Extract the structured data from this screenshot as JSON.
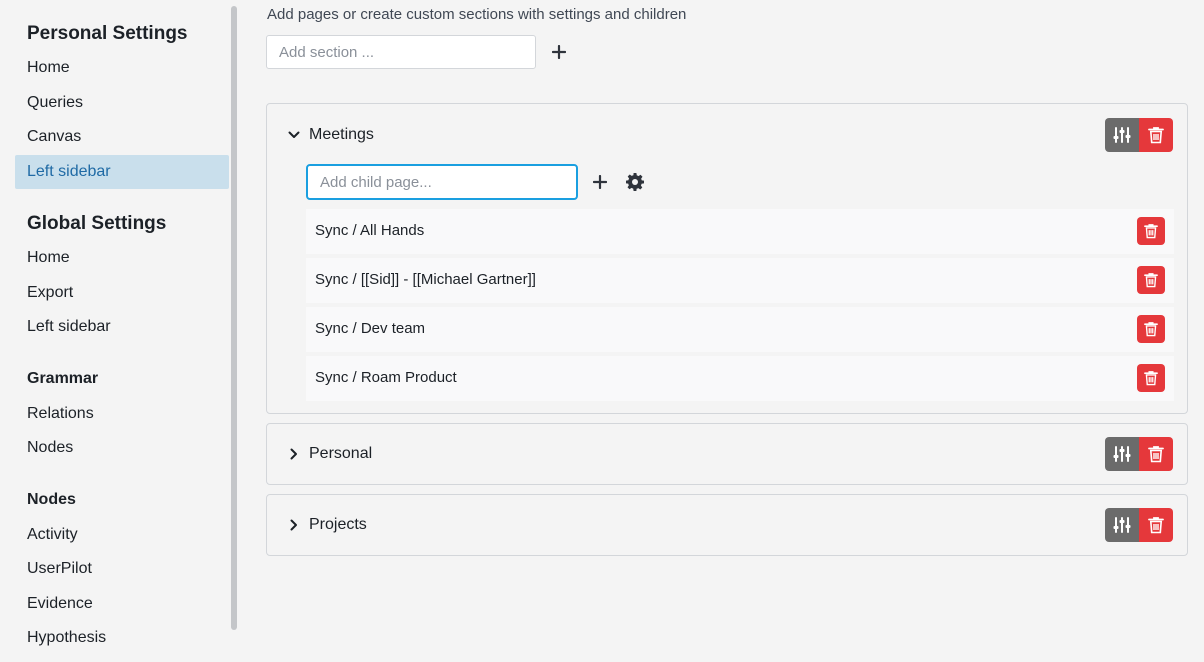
{
  "sidebar": {
    "personal_heading": "Personal Settings",
    "personal_items": [
      {
        "label": "Home"
      },
      {
        "label": "Queries"
      },
      {
        "label": "Canvas"
      },
      {
        "label": "Left sidebar"
      }
    ],
    "global_heading": "Global Settings",
    "global_items": [
      {
        "label": "Home"
      },
      {
        "label": "Export"
      },
      {
        "label": "Left sidebar"
      }
    ],
    "grammar_heading": "Grammar",
    "grammar_items": [
      {
        "label": "Relations"
      },
      {
        "label": "Nodes"
      }
    ],
    "nodes_heading": "Nodes",
    "nodes_items": [
      {
        "label": "Activity"
      },
      {
        "label": "UserPilot"
      },
      {
        "label": "Evidence"
      },
      {
        "label": "Hypothesis"
      }
    ]
  },
  "main": {
    "description": "Add pages or create custom sections with settings and children",
    "add_section_placeholder": "Add section ...",
    "sections": [
      {
        "title": "Meetings",
        "expanded": true,
        "child_placeholder": "Add child page...",
        "children": [
          {
            "label": "Sync / All Hands"
          },
          {
            "label": "Sync / [[Sid]] - [[Michael Gartner]]"
          },
          {
            "label": "Sync / Dev team"
          },
          {
            "label": "Sync / Roam Product"
          }
        ]
      },
      {
        "title": "Personal",
        "expanded": false
      },
      {
        "title": "Projects",
        "expanded": false
      }
    ]
  },
  "colors": {
    "active_bg": "#c9dfec",
    "active_text": "#1f6aa5",
    "danger": "#e5383b",
    "settings_button": "#6b6b6b",
    "focus_border": "#1a9fe0"
  },
  "icons": [
    "plus-icon",
    "gear-icon",
    "sliders-icon",
    "trash-icon",
    "chevron-down-icon",
    "chevron-right-icon"
  ]
}
